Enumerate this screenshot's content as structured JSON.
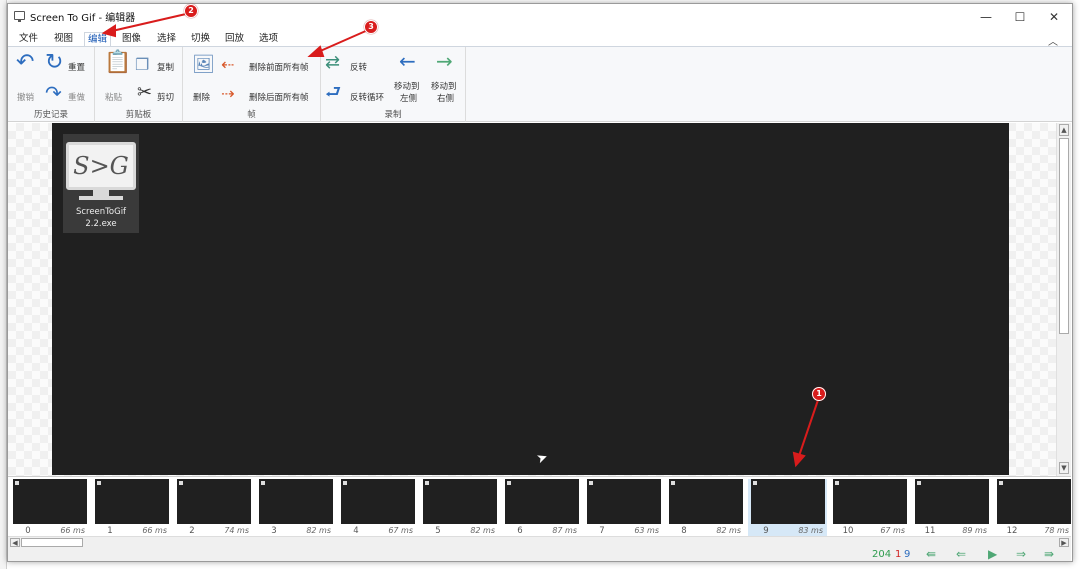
{
  "window": {
    "title": "Screen To Gif - 编辑器",
    "minimize": "—",
    "maximize": "☐",
    "close": "✕"
  },
  "tabs": [
    {
      "label": "文件"
    },
    {
      "label": "视图"
    },
    {
      "label": "编辑",
      "active": true
    },
    {
      "label": "图像"
    },
    {
      "label": "选择"
    },
    {
      "label": "切换"
    },
    {
      "label": "回放"
    },
    {
      "label": "选项"
    }
  ],
  "ribbon": {
    "history": {
      "label": "历史记录",
      "undo": "撤销",
      "reset": "重置",
      "redo": "重做"
    },
    "clipboard": {
      "label": "剪贴板",
      "paste": "粘贴",
      "copy": "复制",
      "cut": "剪切"
    },
    "frames": {
      "label": "帧",
      "delete": "删除",
      "delete_previous": "删除前面所有帧",
      "delete_next": "删除后面所有帧"
    },
    "reorder": {
      "label": "录制",
      "reverse": "反转",
      "yoyo": "反转循环",
      "move_left_1": "移动到",
      "move_left_2": "左侧",
      "move_right_1": "移动到",
      "move_right_2": "右侧"
    }
  },
  "canvas": {
    "desktop_icon_glyph": "S>G",
    "desktop_icon_name_1": "ScreenToGif",
    "desktop_icon_name_2": "2.2.exe"
  },
  "timeline": {
    "frames": [
      {
        "index": "0",
        "delay": "66 ms"
      },
      {
        "index": "1",
        "delay": "66 ms"
      },
      {
        "index": "2",
        "delay": "74 ms"
      },
      {
        "index": "3",
        "delay": "82 ms"
      },
      {
        "index": "4",
        "delay": "67 ms"
      },
      {
        "index": "5",
        "delay": "82 ms"
      },
      {
        "index": "6",
        "delay": "87 ms"
      },
      {
        "index": "7",
        "delay": "63 ms"
      },
      {
        "index": "8",
        "delay": "82 ms"
      },
      {
        "index": "9",
        "delay": "83 ms",
        "selected": true
      },
      {
        "index": "10",
        "delay": "67 ms"
      },
      {
        "index": "11",
        "delay": "89 ms"
      },
      {
        "index": "12",
        "delay": "78 ms"
      }
    ]
  },
  "status": {
    "total_frames": "204",
    "selected_count": "1",
    "current_frame": "9"
  },
  "annotations": [
    {
      "label": "1"
    },
    {
      "label": "2"
    },
    {
      "label": "3"
    }
  ],
  "colors": {
    "annotation_red": "#d91c1c",
    "active_tab_blue": "#1a59b5",
    "nav_green": "#4fa775"
  }
}
